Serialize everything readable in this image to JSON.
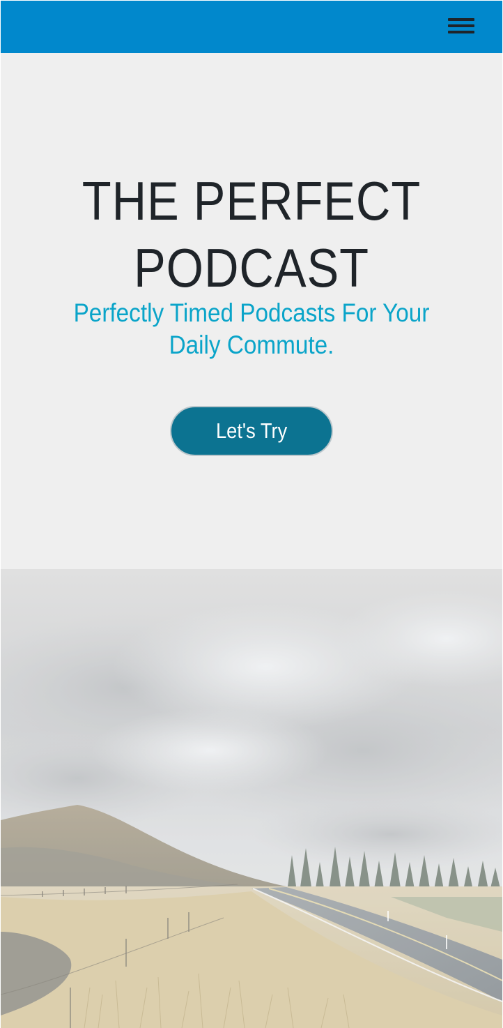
{
  "navbar": {
    "background_color": "#0188cc",
    "menu_icon": "hamburger-menu-icon"
  },
  "hero": {
    "title": "THE PERFECT PODCAST",
    "subtitle": "Perfectly Timed Podcasts For Your Daily Commute.",
    "cta_label": "Let's Try",
    "accent_color": "#0aa4c9",
    "button_color": "#0c7391"
  },
  "landscape": {
    "description_icon": "road-landscape-image"
  }
}
